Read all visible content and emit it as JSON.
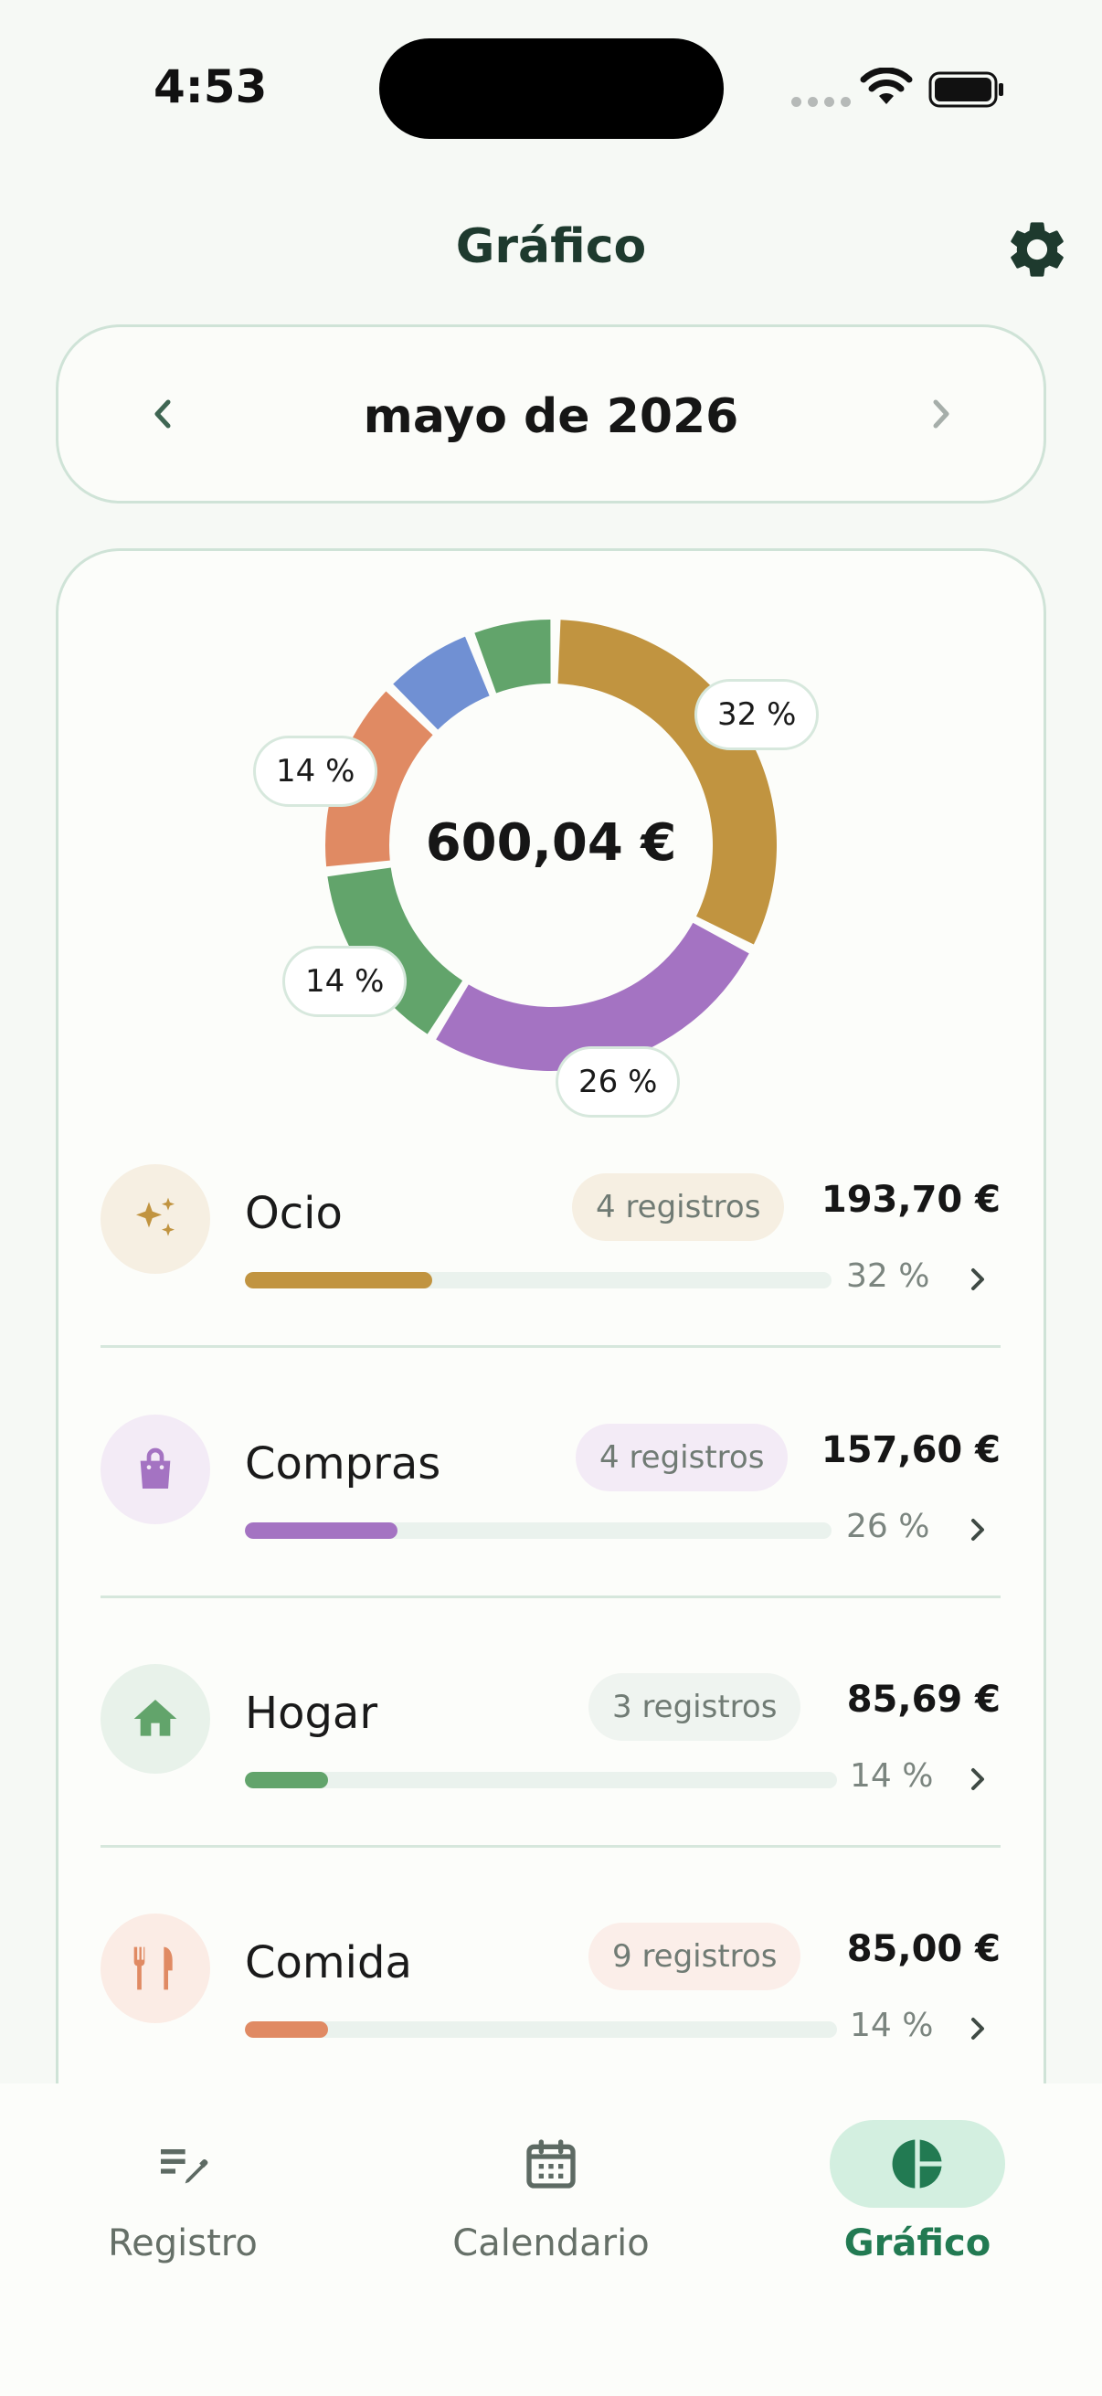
{
  "status_bar": {
    "time": "4:53"
  },
  "header": {
    "title": "Gráfico"
  },
  "month_selector": {
    "label": "mayo de 2026"
  },
  "summary": {
    "total": "600,04 €"
  },
  "chart_data": {
    "type": "pie",
    "donut": true,
    "slices": [
      {
        "name": "Ocio",
        "value": 193.7,
        "percent_label": "32 %",
        "color": "#c19440"
      },
      {
        "name": "Compras",
        "value": 157.6,
        "percent_label": "26 %",
        "color": "#a473c2"
      },
      {
        "name": "Hogar",
        "value": 85.69,
        "percent_label": "14 %",
        "color": "#62a46b"
      },
      {
        "name": "Comida",
        "value": 85.0,
        "percent_label": "14 %",
        "color": "#e08a63"
      },
      {
        "name": "",
        "value": 41.0,
        "percent_label": "",
        "color": "#7090d3"
      },
      {
        "name": "",
        "value": 37.05,
        "percent_label": "",
        "color": "#62a46b"
      }
    ]
  },
  "categories": [
    {
      "name": "Ocio",
      "count": "4 registros",
      "amount": "193,70 €",
      "percent": "32 %",
      "fraction": 0.32,
      "color": "#c19440",
      "bg": "#f6efe2",
      "icon": "sparkles-icon"
    },
    {
      "name": "Compras",
      "count": "4 registros",
      "amount": "157,60 €",
      "percent": "26 %",
      "fraction": 0.26,
      "color": "#a473c2",
      "bg": "#f3ebf6",
      "icon": "shopping-bag-icon"
    },
    {
      "name": "Hogar",
      "count": "3 registros",
      "amount": "85,69 €",
      "percent": "14 %",
      "fraction": 0.14,
      "color": "#62a46b",
      "bg": "#e8f2ea",
      "icon": "home-icon"
    },
    {
      "name": "Comida",
      "count": "9 registros",
      "amount": "85,00 €",
      "percent": "14 %",
      "fraction": 0.14,
      "color": "#e08a63",
      "bg": "#fbece5",
      "icon": "fork-knife-icon"
    }
  ],
  "tabs": [
    {
      "label": "Registro",
      "icon": "edit-list-icon",
      "active": false
    },
    {
      "label": "Calendario",
      "icon": "calendar-icon",
      "active": false
    },
    {
      "label": "Gráfico",
      "icon": "pie-chart-icon",
      "active": true
    }
  ],
  "colors": {
    "accent": "#227a52",
    "background": "#f6f9f5",
    "border": "#cfe3d7"
  }
}
